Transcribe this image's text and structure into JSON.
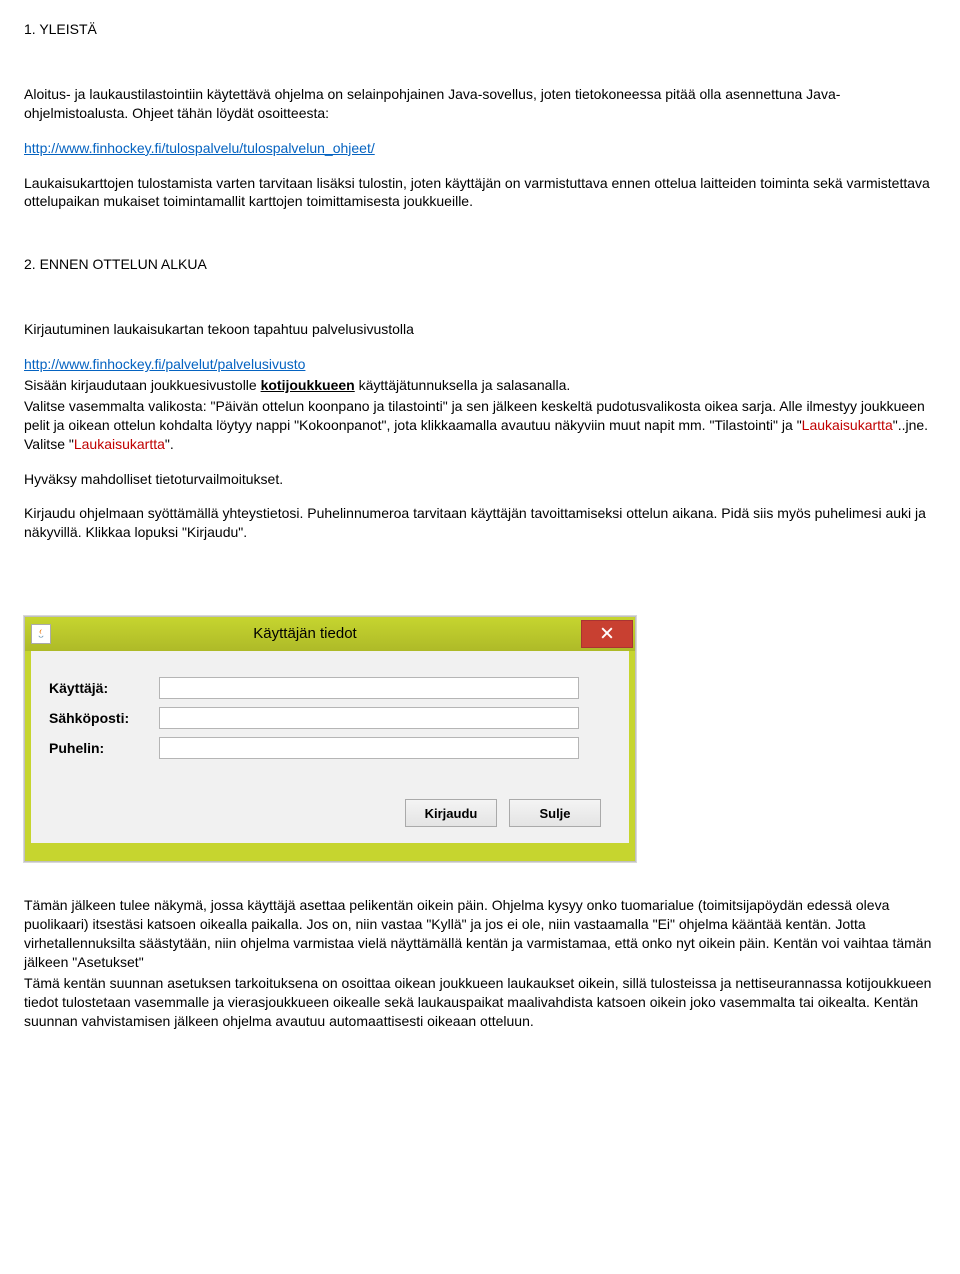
{
  "doc": {
    "section1_title": "1. YLEISTÄ",
    "p1": "Aloitus- ja laukaustilastointiin käytettävä ohjelma on selainpohjainen Java-sovellus, joten tietokoneessa pitää olla asennettuna Java-ohjelmistoalusta. Ohjeet tähän löydät osoitteesta:",
    "link1": "http://www.finhockey.fi/tulospalvelu/tulospalvelun_ohjeet/",
    "p2": "Laukaisukarttojen tulostamista varten tarvitaan lisäksi tulostin, joten käyttäjän on varmistuttava ennen ottelua laitteiden toiminta sekä varmistettava ottelupaikan mukaiset toimintamallit karttojen toimittamisesta joukkueille.",
    "section2_title": "2. ENNEN OTTELUN  ALKUA",
    "p3": "Kirjautuminen laukaisukartan tekoon tapahtuu palvelusivustolla",
    "link2": "http://www.finhockey.fi/palvelut/palvelusivusto",
    "p4a": "Sisään kirjaudutaan joukkuesivustolle ",
    "p4_kw": "kotijoukkueen",
    "p4b": " käyttäjätunnuksella ja salasanalla.",
    "p5": "Valitse vasemmalta valikosta: \"Päivän ottelun koonpano ja tilastointi\" ja sen jälkeen keskeltä pudotusvalikosta oikea sarja. Alle ilmestyy joukkueen pelit ja oikean ottelun kohdalta löytyy nappi \"Kokoonpanot\", jota klikkaamalla avautuu näkyviin muut napit mm. \"Tilastointi\" ja ",
    "p5_red1": "Laukaisukartta",
    "p5_mid": "\"..jne.  Valitse \"",
    "p5_red2": "Laukaisukartta",
    "p5_end": "\".",
    "p6": "Hyväksy mahdolliset tietoturvailmoitukset.",
    "p7": "Kirjaudu ohjelmaan syöttämällä yhteystietosi. Puhelinnumeroa tarvitaan käyttäjän tavoittamiseksi ottelun aikana. Pidä siis myös puhelimesi auki ja näkyvillä. Klikkaa lopuksi \"Kirjaudu\".",
    "p8": "Tämän jälkeen tulee näkymä, jossa käyttäjä asettaa pelikentän oikein päin. Ohjelma kysyy onko tuomarialue (toimitsijapöydän edessä oleva puolikaari) itsestäsi katsoen oikealla paikalla. Jos on, niin vastaa \"Kyllä\" ja jos ei ole, niin vastaamalla \"Ei\" ohjelma kääntää kentän. Jotta virhetallennuksilta säästytään, niin ohjelma varmistaa vielä näyttämällä kentän ja varmistamaa, että onko nyt oikein päin. Kentän voi vaihtaa tämän jälkeen \"Asetukset\"",
    "p9": "Tämä kentän suunnan asetuksen tarkoituksena on osoittaa oikean joukkueen laukaukset oikein, sillä tulosteissa ja nettiseurannassa kotijoukkueen tiedot tulostetaan vasemmalle ja vierasjoukkueen oikealle sekä laukauspaikat maalivahdista katsoen oikein joko vasemmalta tai oikealta. Kentän suunnan vahvistamisen jälkeen ohjelma avautuu automaattisesti oikeaan otteluun."
  },
  "dialog": {
    "title": "Käyttäjän tiedot",
    "labels": {
      "user": "Käyttäjä:",
      "email": "Sähköposti:",
      "phone": "Puhelin:"
    },
    "fields": {
      "user": "",
      "email": "",
      "phone": ""
    },
    "buttons": {
      "login": "Kirjaudu",
      "close": "Sulje"
    }
  }
}
